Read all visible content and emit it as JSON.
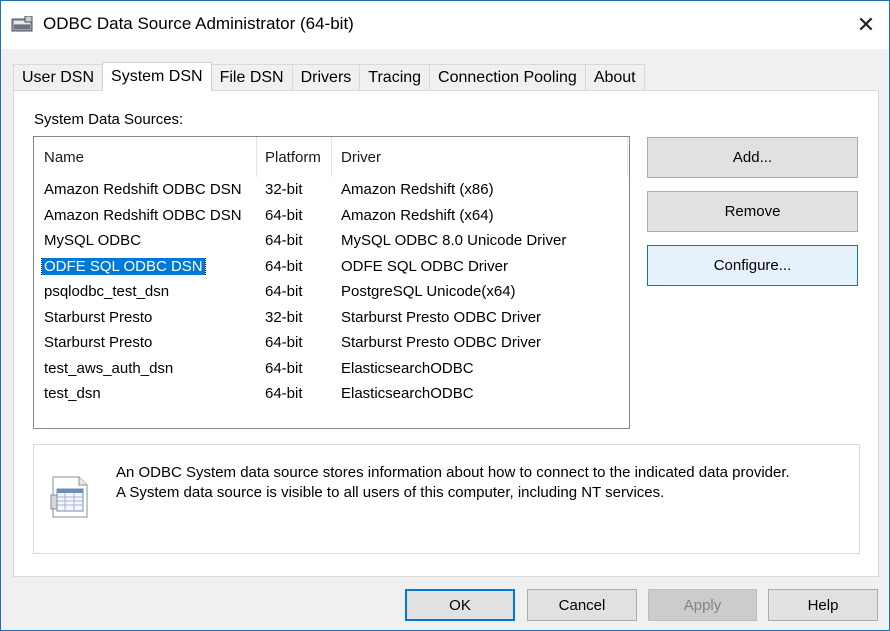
{
  "window": {
    "title": "ODBC Data Source Administrator (64-bit)",
    "close_glyph": "✕"
  },
  "tabs": [
    {
      "label": "User DSN",
      "active": false
    },
    {
      "label": "System DSN",
      "active": true
    },
    {
      "label": "File DSN",
      "active": false
    },
    {
      "label": "Drivers",
      "active": false
    },
    {
      "label": "Tracing",
      "active": false
    },
    {
      "label": "Connection Pooling",
      "active": false
    },
    {
      "label": "About",
      "active": false
    }
  ],
  "system_dsn": {
    "section_label": "System Data Sources:",
    "columns": {
      "name": "Name",
      "platform": "Platform",
      "driver": "Driver"
    },
    "rows": [
      {
        "name": "Amazon Redshift ODBC DSN",
        "platform": "32-bit",
        "driver": "Amazon Redshift (x86)"
      },
      {
        "name": "Amazon Redshift ODBC DSN",
        "platform": "64-bit",
        "driver": "Amazon Redshift (x64)"
      },
      {
        "name": "MySQL ODBC",
        "platform": "64-bit",
        "driver": "MySQL ODBC 8.0 Unicode Driver"
      },
      {
        "name": "ODFE SQL ODBC DSN",
        "platform": "64-bit",
        "driver": "ODFE SQL ODBC Driver",
        "selected": true
      },
      {
        "name": "psqlodbc_test_dsn",
        "platform": "64-bit",
        "driver": "PostgreSQL Unicode(x64)"
      },
      {
        "name": "Starburst Presto",
        "platform": "32-bit",
        "driver": "Starburst Presto ODBC Driver"
      },
      {
        "name": "Starburst Presto",
        "platform": "64-bit",
        "driver": "Starburst Presto ODBC Driver"
      },
      {
        "name": "test_aws_auth_dsn",
        "platform": "64-bit",
        "driver": "ElasticsearchODBC"
      },
      {
        "name": "test_dsn",
        "platform": "64-bit",
        "driver": "ElasticsearchODBC"
      }
    ],
    "buttons": {
      "add": "Add...",
      "remove": "Remove",
      "configure": "Configure..."
    },
    "info": {
      "line1": "An ODBC System data source stores information about how to connect to the indicated data provider.",
      "line2": "A System data source is visible to all users of this computer, including NT services."
    }
  },
  "footer": {
    "ok": "OK",
    "cancel": "Cancel",
    "apply": "Apply",
    "help": "Help"
  },
  "colors": {
    "accent": "#0078d7",
    "selection": "#0078d7",
    "button_face": "#e1e1e1"
  }
}
